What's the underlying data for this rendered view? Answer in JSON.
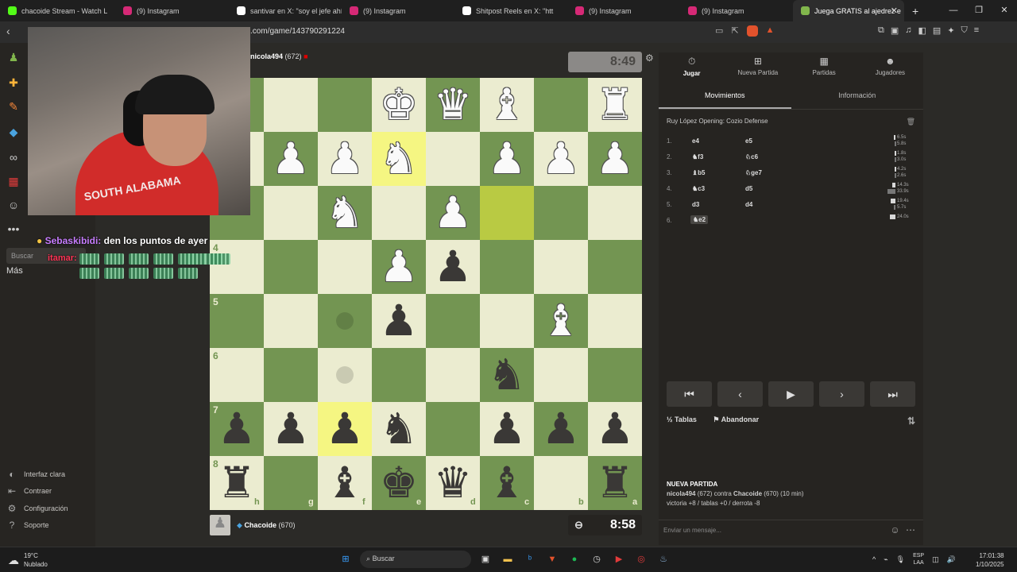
{
  "browser": {
    "tabs": [
      {
        "label": "chacoide Stream - Watch L",
        "color": "#53fc18"
      },
      {
        "label": "(9) Instagram",
        "color": "#d62976"
      },
      {
        "label": "santivar en X: \"soy el jefe ahí h",
        "color": "#ffffff"
      },
      {
        "label": "(9) Instagram",
        "color": "#d62976"
      },
      {
        "label": "Shitpost Reels en X: \"htt",
        "color": "#ffffff"
      },
      {
        "label": "(9) Instagram",
        "color": "#d62976"
      },
      {
        "label": "(9) Instagram",
        "color": "#d62976"
      },
      {
        "label": "Juega GRATIS al ajedrez e",
        "color": "#81b64c"
      }
    ],
    "url": "s.com/game/143790291224"
  },
  "sidebar": {
    "mas": "Más",
    "search_placeholder": "Buscar",
    "bottom": [
      {
        "label": "Interfaz clara",
        "icon": "half-circle-icon"
      },
      {
        "label": "Contraer",
        "icon": "collapse-icon"
      },
      {
        "label": "Configuración",
        "icon": "gear-icon"
      },
      {
        "label": "Soporte",
        "icon": "help-icon"
      }
    ]
  },
  "chat_overlay": {
    "user1": "Sebaskibidi:",
    "msg1": " den los puntos de ayer",
    "user2": "itamar:"
  },
  "webcam": {
    "shirt_text": "SOUTH ALABAMA"
  },
  "game": {
    "opponent": {
      "name": "nicola494",
      "rating": "(672)",
      "clock": "8:49"
    },
    "player": {
      "name": "Chacoide",
      "rating": "(670)",
      "clock": "8:58"
    },
    "ranks": [
      "4",
      "5",
      "6",
      "7",
      "8"
    ],
    "files": [
      "h",
      "g",
      "f",
      "e",
      "d",
      "c",
      "b",
      "a"
    ]
  },
  "panel": {
    "tabs": [
      {
        "label": "Jugar",
        "icon": "stopwatch-icon"
      },
      {
        "label": "Nueva Partida",
        "icon": "plus-board-icon"
      },
      {
        "label": "Partidas",
        "icon": "board-icon"
      },
      {
        "label": "Jugadores",
        "icon": "players-icon"
      }
    ],
    "subtabs": [
      "Movimientos",
      "Información"
    ],
    "opening": "Ruy López Opening: Cozio Defense",
    "moves": [
      {
        "num": "1.",
        "white": "e4",
        "black": "e5",
        "t1": "6.5s",
        "t2": "5.8s"
      },
      {
        "num": "2.",
        "white": "♞f3",
        "black": "♘c6",
        "t1": "1.8s",
        "t2": "3.0s"
      },
      {
        "num": "3.",
        "white": "♝b5",
        "black": "♘ge7",
        "t1": "4.2s",
        "t2": "2.6s"
      },
      {
        "num": "4.",
        "white": "♞c3",
        "black": "d5",
        "t1": "14.3s",
        "t2": "33.9s"
      },
      {
        "num": "5.",
        "white": "d3",
        "black": "d4",
        "t1": "19.4s",
        "t2": "5.7s"
      },
      {
        "num": "6.",
        "white": "♞e2",
        "black": "",
        "t1": "24.0s",
        "t2": ""
      }
    ],
    "draw": "Tablas",
    "draw_icon": "½",
    "resign": "Abandonar",
    "info_title": "NUEVA PARTIDA",
    "info_line1_a": "nicola494",
    "info_line1_b": " (672) contra ",
    "info_line1_c": "Chacoide",
    "info_line1_d": " (670) (10 min)",
    "info_line2": "victoria +8 / tablas +0 / derrota -8",
    "chat_placeholder": "Enviar un mensaje..."
  },
  "taskbar": {
    "temp": "19°C",
    "weather": "Nublado",
    "search": "Buscar",
    "lang1": "ESP",
    "lang2": "LAA",
    "time": "17:01:38",
    "date": "1/10/2025"
  }
}
